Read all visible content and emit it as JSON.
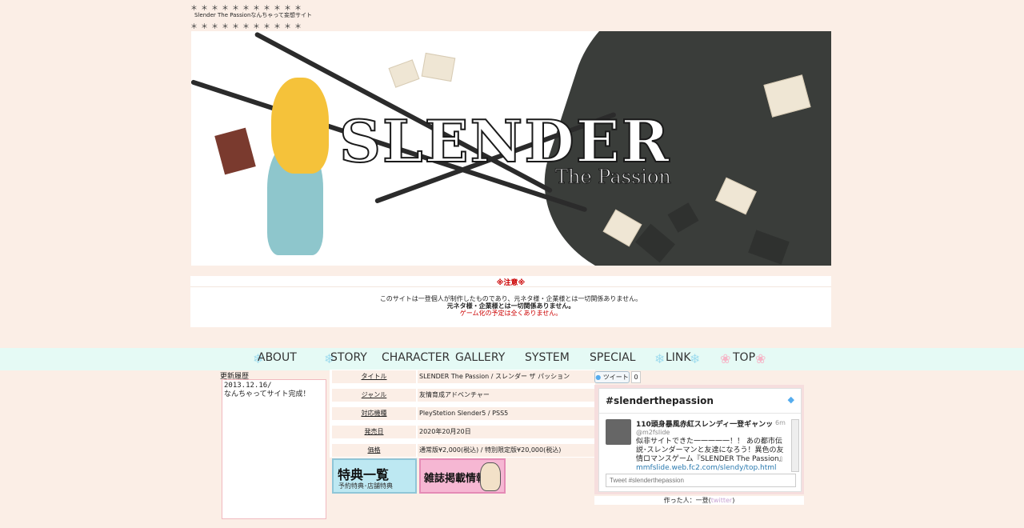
{
  "header": {
    "stars": "＊＊＊＊＊＊＊＊＊＊＊",
    "subtitle": "Slender The Passionなんちゃって妄想サイト"
  },
  "banner": {
    "title": "SLENDER",
    "subtitle": "The Passion"
  },
  "notice": {
    "title": "※注意※",
    "line1": "このサイトは一登個人が制作したものであり、元ネタ様・企業様とは一切関係ありません。",
    "line2": "元ネタ様・企業様とは一切関係ありません。",
    "line3": "ゲーム化の予定は全くありません。"
  },
  "nav": {
    "items": [
      "ABOUT",
      "STORY",
      "CHARACTER",
      "GALLERY",
      "SYSTEM",
      "SPECIAL",
      "LINK",
      "TOP"
    ]
  },
  "updates": {
    "label": "更新履歴",
    "entry_date": "2013.12.16/",
    "entry_text": "なんちゃってサイト完成！"
  },
  "info": {
    "rows": [
      {
        "key": "タイトル",
        "value": "SLENDER The Passion / スレンダー ザ パッション"
      },
      {
        "key": "ジャンル",
        "value": "友情育成アドベンチャー"
      },
      {
        "key": "対応機種",
        "value": "PleyStetion Slender5 / PSS5"
      },
      {
        "key": "発売日",
        "value": "2020年20月20日"
      },
      {
        "key": "価格",
        "value": "通常版¥2,000(税込) / 特別限定版¥20,000(税込)"
      }
    ]
  },
  "promos": {
    "bonus_title": "特典一覧",
    "bonus_sub": "予約特典･店舗特典",
    "magazine_title": "雑誌掲載情報"
  },
  "twitter": {
    "tweet_button": "ツイート",
    "count": "0",
    "hashtag": "#slenderthepassion",
    "name": "110頭身暴風赤紅スレンディ一登ギャンッ",
    "time": "6m",
    "handle": "@m2fslide",
    "text": "似非サイトできた一一一一一！！ あの都市伝説･スレンダーマンと友達になろう！異色の友情ロマンスゲーム『SLENDER The Passion』",
    "link": "mmfslide.web.fc2.com/slendy/top.html",
    "input_placeholder": "Tweet #slenderthepassion"
  },
  "maker": {
    "label": "作った人：一登(",
    "link": "twitter",
    "close": ")"
  }
}
